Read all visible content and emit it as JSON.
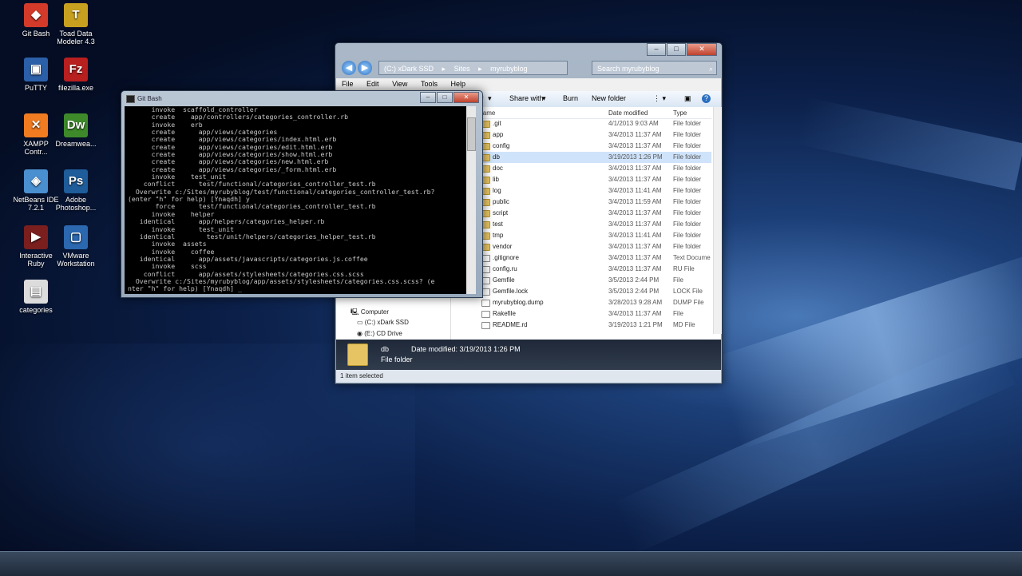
{
  "desktop": {
    "icons": [
      {
        "label": "Git Bash",
        "color": "#d33a2a",
        "glyph": "◆"
      },
      {
        "label": "Toad Data Modeler 4.3",
        "color": "#c8a020",
        "glyph": "T"
      },
      {
        "label": "PuTTY",
        "color": "#2b5fa8",
        "glyph": "▣"
      },
      {
        "label": "filezilla.exe",
        "color": "#b81f1f",
        "glyph": "Fz"
      },
      {
        "label": "XAMPP Contr...",
        "color": "#f07b20",
        "glyph": "✕"
      },
      {
        "label": "Dreamwea...",
        "color": "#3e8a2a",
        "glyph": "Dw"
      },
      {
        "label": "NetBeans IDE 7.2.1",
        "color": "#4a8fd0",
        "glyph": "◈"
      },
      {
        "label": "Adobe Photoshop...",
        "color": "#1e5c9a",
        "glyph": "Ps"
      },
      {
        "label": "Interactive Ruby",
        "color": "#7a1e1e",
        "glyph": "▶"
      },
      {
        "label": "VMware Workstation",
        "color": "#2b68b0",
        "glyph": "▢"
      },
      {
        "label": "categories",
        "color": "#dcdcdc",
        "glyph": "▤"
      }
    ]
  },
  "gitbash": {
    "title": "Git Bash",
    "lines": [
      "      invoke  scaffold_controller",
      "      create    app/controllers/categories_controller.rb",
      "      invoke    erb",
      "      create      app/views/categories",
      "      create      app/views/categories/index.html.erb",
      "      create      app/views/categories/edit.html.erb",
      "      create      app/views/categories/show.html.erb",
      "      create      app/views/categories/new.html.erb",
      "      create      app/views/categories/_form.html.erb",
      "      invoke    test_unit",
      "    conflict      test/functional/categories_controller_test.rb",
      "  Overwrite c:/Sites/myrubyblog/test/functional/categories_controller_test.rb?",
      "(enter \"h\" for help) [Ynaqdh] y",
      "       force      test/functional/categories_controller_test.rb",
      "      invoke    helper",
      "   identical      app/helpers/categories_helper.rb",
      "      invoke      test_unit",
      "   identical        test/unit/helpers/categories_helper_test.rb",
      "      invoke  assets",
      "      invoke    coffee",
      "   identical      app/assets/javascripts/categories.js.coffee",
      "      invoke    scss",
      "    conflict      app/assets/stylesheets/categories.css.scss",
      "  Overwrite c:/Sites/myrubyblog/app/assets/stylesheets/categories.css.scss? (e",
      "nter \"h\" for help) [Ynaqdh] _"
    ]
  },
  "explorer": {
    "address": [
      "(C:) xDark SSD",
      "Sites",
      "myrubyblog"
    ],
    "search_placeholder": "Search myrubyblog",
    "menu": [
      "File",
      "Edit",
      "View",
      "Tools",
      "Help"
    ],
    "toolbar": {
      "organize": "y",
      "share": "Share with",
      "burn": "Burn",
      "new_folder": "New folder"
    },
    "columns": {
      "name": "Name",
      "date": "Date modified",
      "type": "Type"
    },
    "files": [
      {
        "name": ".git",
        "date": "4/1/2013 9:03 AM",
        "type": "File folder",
        "kind": "folder"
      },
      {
        "name": "app",
        "date": "3/4/2013 11:37 AM",
        "type": "File folder",
        "kind": "folder"
      },
      {
        "name": "config",
        "date": "3/4/2013 11:37 AM",
        "type": "File folder",
        "kind": "folder"
      },
      {
        "name": "db",
        "date": "3/19/2013 1:26 PM",
        "type": "File folder",
        "kind": "folder",
        "selected": true
      },
      {
        "name": "doc",
        "date": "3/4/2013 11:37 AM",
        "type": "File folder",
        "kind": "folder"
      },
      {
        "name": "lib",
        "date": "3/4/2013 11:37 AM",
        "type": "File folder",
        "kind": "folder"
      },
      {
        "name": "log",
        "date": "3/4/2013 11:41 AM",
        "type": "File folder",
        "kind": "folder"
      },
      {
        "name": "public",
        "date": "3/4/2013 11:59 AM",
        "type": "File folder",
        "kind": "folder"
      },
      {
        "name": "script",
        "date": "3/4/2013 11:37 AM",
        "type": "File folder",
        "kind": "folder"
      },
      {
        "name": "test",
        "date": "3/4/2013 11:37 AM",
        "type": "File folder",
        "kind": "folder"
      },
      {
        "name": "tmp",
        "date": "3/4/2013 11:41 AM",
        "type": "File folder",
        "kind": "folder"
      },
      {
        "name": "vendor",
        "date": "3/4/2013 11:37 AM",
        "type": "File folder",
        "kind": "folder"
      },
      {
        "name": ".gitignore",
        "date": "3/4/2013 11:37 AM",
        "type": "Text Docume",
        "kind": "file"
      },
      {
        "name": "config.ru",
        "date": "3/4/2013 11:37 AM",
        "type": "RU File",
        "kind": "file"
      },
      {
        "name": "Gemfile",
        "date": "3/5/2013 2:44 PM",
        "type": "File",
        "kind": "file"
      },
      {
        "name": "Gemfile.lock",
        "date": "3/5/2013 2:44 PM",
        "type": "LOCK File",
        "kind": "file"
      },
      {
        "name": "myrubyblog.dump",
        "date": "3/28/2013 9:28 AM",
        "type": "DUMP File",
        "kind": "file"
      },
      {
        "name": "Rakefile",
        "date": "3/4/2013 11:37 AM",
        "type": "File",
        "kind": "file"
      },
      {
        "name": "README.rd",
        "date": "3/19/2013 1:21 PM",
        "type": "MD File",
        "kind": "file"
      }
    ],
    "nav": [
      {
        "label": "Computer"
      },
      {
        "label": "(C:) xDark SSD"
      },
      {
        "label": "(E:) CD Drive"
      }
    ],
    "details": {
      "name": "db",
      "date_label": "Date modified: 3/19/2013 1:26 PM",
      "kind": "File folder"
    },
    "status": "1 item selected"
  }
}
